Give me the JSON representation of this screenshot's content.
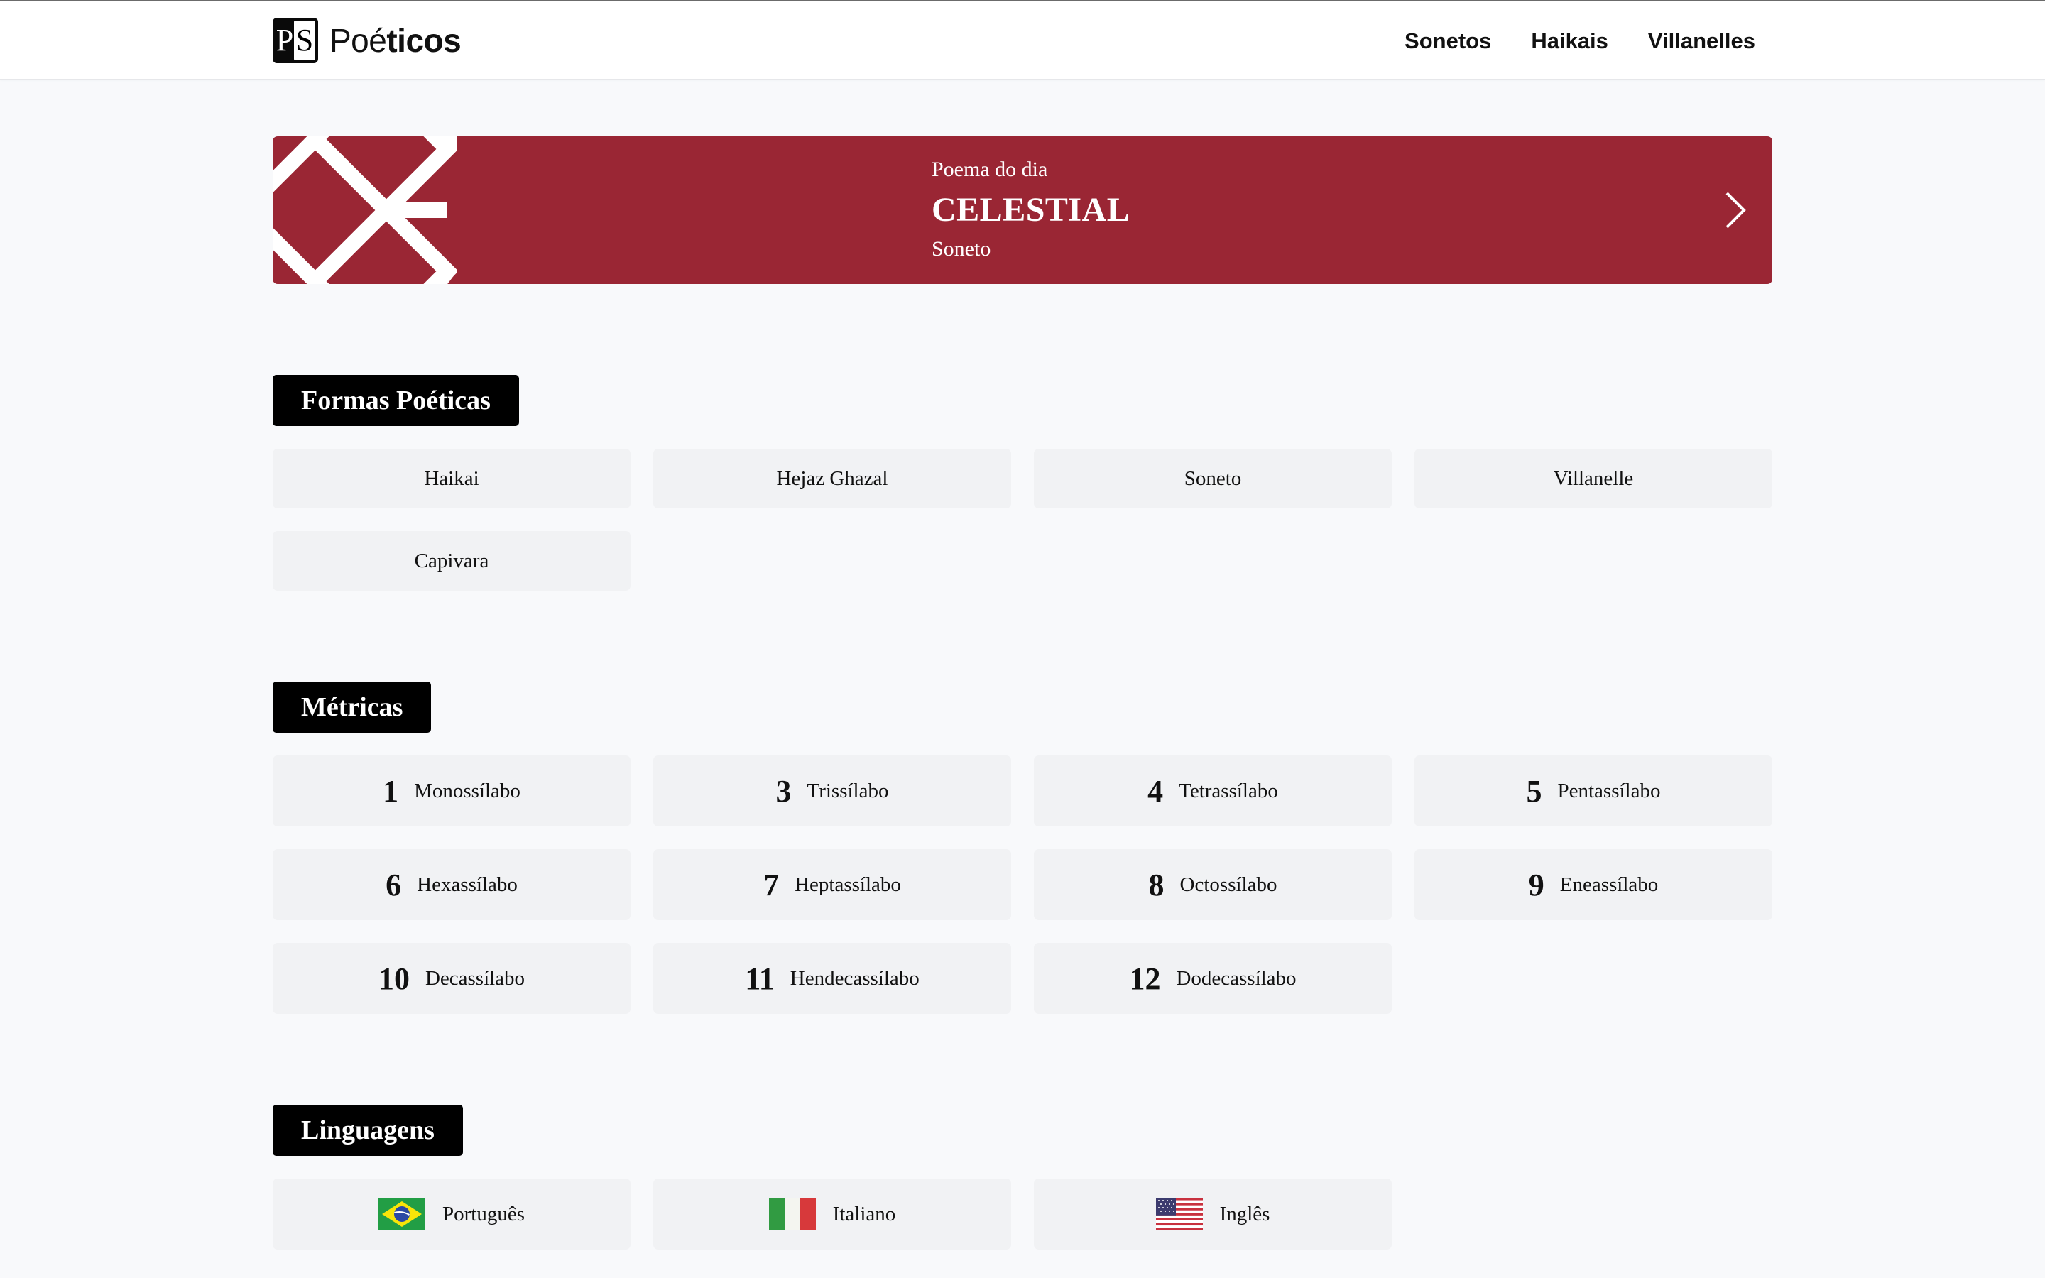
{
  "header": {
    "logo_letters": [
      "P",
      "S"
    ],
    "brand_regular": "Poé",
    "brand_bold": "ticos",
    "nav": [
      "Sonetos",
      "Haikais",
      "Villanelles"
    ]
  },
  "banner": {
    "kicker": "Poema do dia",
    "title": "CELESTIAL",
    "subtitle": "Soneto",
    "color": "#9a2634",
    "icon": "chevron-right-icon"
  },
  "sections": {
    "formas": {
      "title": "Formas Poéticas",
      "items": [
        "Haikai",
        "Hejaz Ghazal",
        "Soneto",
        "Villanelle",
        "Capivara"
      ]
    },
    "metricas": {
      "title": "Métricas",
      "items": [
        {
          "num": "1",
          "label": "Monossílabo"
        },
        {
          "num": "3",
          "label": "Trissílabo"
        },
        {
          "num": "4",
          "label": "Tetrassílabo"
        },
        {
          "num": "5",
          "label": "Pentassílabo"
        },
        {
          "num": "6",
          "label": "Hexassílabo"
        },
        {
          "num": "7",
          "label": "Heptassílabo"
        },
        {
          "num": "8",
          "label": "Octossílabo"
        },
        {
          "num": "9",
          "label": "Eneassílabo"
        },
        {
          "num": "10",
          "label": "Decassílabo"
        },
        {
          "num": "11",
          "label": "Hendecassílabo"
        },
        {
          "num": "12",
          "label": "Dodecassílabo"
        }
      ]
    },
    "linguagens": {
      "title": "Linguagens",
      "items": [
        {
          "label": "Português",
          "icon": "brazil-flag-icon"
        },
        {
          "label": "Italiano",
          "icon": "italy-flag-icon"
        },
        {
          "label": "Inglês",
          "icon": "usa-flag-icon"
        }
      ]
    }
  }
}
